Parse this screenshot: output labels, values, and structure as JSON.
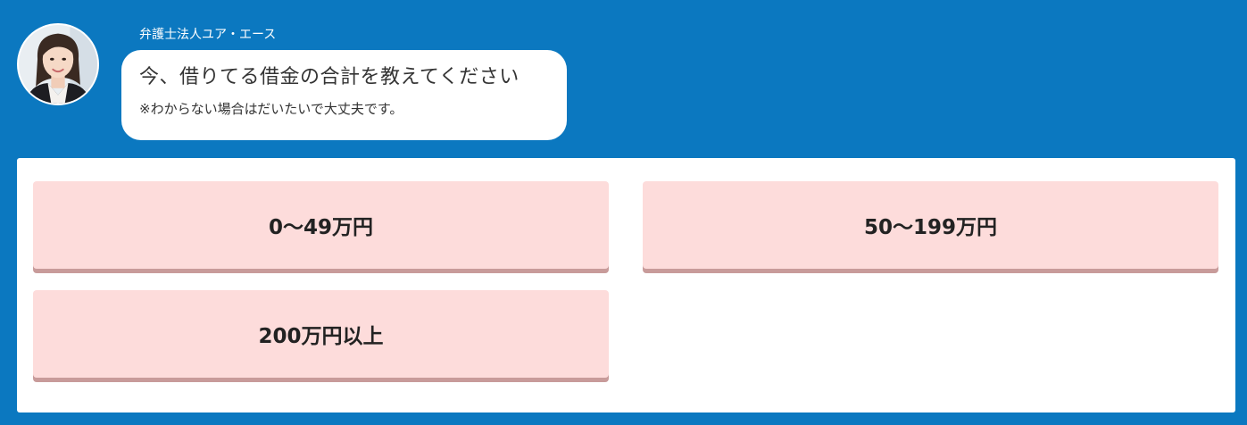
{
  "header": {
    "sender_name": "弁護士法人ユア・エース",
    "avatar_icon": "woman-portrait-avatar"
  },
  "message": {
    "question": "今、借りてる借金の合計を教えてください",
    "note": "※わからない場合はだいたいで大丈夫です。"
  },
  "options": [
    {
      "label": "0〜49万円"
    },
    {
      "label": "50〜199万円"
    },
    {
      "label": "200万円以上"
    }
  ],
  "colors": {
    "background": "#0b78c0",
    "panel": "#ffffff",
    "option_fill": "#fddcdb",
    "option_shadow": "#c89b9a",
    "text_dark": "#222222"
  }
}
